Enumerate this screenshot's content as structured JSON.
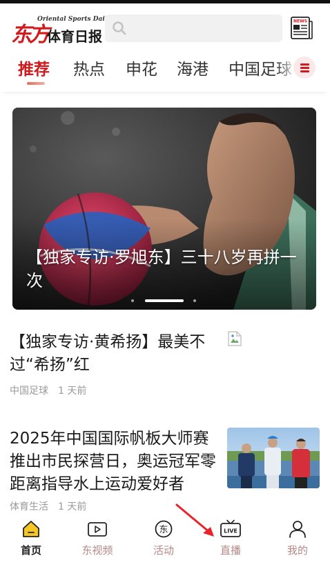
{
  "app": {
    "logo_mark": "东方",
    "logo_subtitle": "Oriental Sports Daily",
    "logo_name": "体育日报",
    "news_icon_text": "NEWS"
  },
  "search": {
    "placeholder": "",
    "value": ""
  },
  "tabs": [
    {
      "label": "推荐",
      "active": true
    },
    {
      "label": "热点",
      "active": false
    },
    {
      "label": "申花",
      "active": false
    },
    {
      "label": "海港",
      "active": false
    },
    {
      "label": "中国足球",
      "active": false
    }
  ],
  "banner": {
    "title": "【独家专访·罗旭东】三十八岁再拼一次",
    "slide_index": 2,
    "slide_count": 3
  },
  "articles": [
    {
      "title": "【独家专访·黄希扬】最美不过“希扬”红",
      "category": "中国足球",
      "time": "1 天前",
      "has_image": false
    },
    {
      "title": "2025年中国国际帆板大师赛推出市民探营日，奥运冠军零距离指导水上运动爱好者",
      "category": "体育生活",
      "time": "1 天前",
      "has_image": true
    }
  ],
  "bottom_nav": [
    {
      "label": "首页",
      "icon": "home-icon",
      "active": true
    },
    {
      "label": "东视频",
      "icon": "video-icon",
      "active": false
    },
    {
      "label": "活动",
      "icon": "activity-icon",
      "active": false
    },
    {
      "label": "直播",
      "icon": "live-icon",
      "active": false
    },
    {
      "label": "我的",
      "icon": "profile-icon",
      "active": false
    }
  ],
  "colors": {
    "brand_red": "#d11a1e",
    "home_icon_yellow": "#f6c623",
    "inactive_label": "#b58787",
    "annotation_arrow": "#e8242a"
  }
}
